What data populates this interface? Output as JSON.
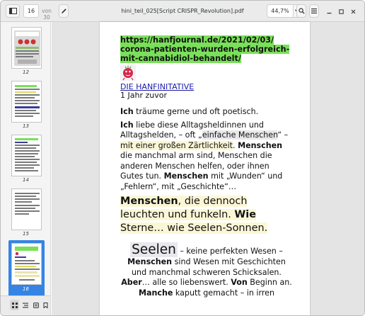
{
  "toolbar": {
    "current_page": "16",
    "page_total": "von 30",
    "title": "hini_teil_025[Script CRISPR_Revolution].pdf",
    "zoom": "44,7%",
    "icons": {
      "sidebar_toggle": "sidebar-toggle-icon",
      "annotate": "pencil-icon",
      "zoom_menu": "chevron-down-icon",
      "search": "search-icon",
      "menu": "hamburger-menu-icon",
      "minimize": "minimize-icon",
      "maximize": "maximize-icon",
      "close": "close-icon"
    }
  },
  "sidebar": {
    "thumbnails": [
      {
        "label": "12"
      },
      {
        "label": "13"
      },
      {
        "label": "14"
      },
      {
        "label": "15"
      },
      {
        "label": "16",
        "selected": true
      }
    ],
    "bottom_buttons": [
      "thumbnails-icon",
      "outline-icon",
      "annotations-icon",
      "bookmarks-icon"
    ]
  },
  "document": {
    "url_lines": [
      "https://hanfjournal.de/2021/02/03/",
      "corona-patienten-wurden-erfolgreich-",
      "mit-cannabidiol-behandelt/"
    ],
    "author": "DIE HANFINITATIVE",
    "time": "1 Jahr zuvor",
    "p1_bold": "Ich",
    "p1_rest": " träume gerne und oft poetisch.",
    "p2": {
      "a_bold": "Ich",
      "b": " liebe diese Alltagsheldinnen und Alltagshelden, – oft „",
      "c_grey": "einfache Menschen",
      "d": "“ –",
      "e_yellow": "mit einer großen Zärtlichkeit",
      "f": ".  ",
      "g_bold": "Menschen",
      "h": " die manchmal arm sind, Menschen die anderen Menschen helfen, oder ihnen Gutes tun. ",
      "i_bold": "Menschen",
      "j": " mit „Wunden“ und „Fehlern“, mit „Geschichte“…"
    },
    "big": {
      "a_bold": "Menschen",
      "b": ", die dennoch leuchten und funkeln. ",
      "c_bold": "Wie",
      "d": " Sterne… wie Seelen-Sonnen."
    },
    "center": {
      "seelen": "Seelen",
      "a": " – keine perfekten Wesen –",
      "b_bold": "Menschen",
      "c": " sind Wesen mit Geschichten und manchmal schweren Schicksalen.",
      "d_bold": "Aber",
      "e": "… alle so liebenswert. ",
      "f_bold": "Von",
      "g": " Beginn an.",
      "h_bold": "Manche",
      "i": " kaputt gemacht – in irren"
    }
  }
}
